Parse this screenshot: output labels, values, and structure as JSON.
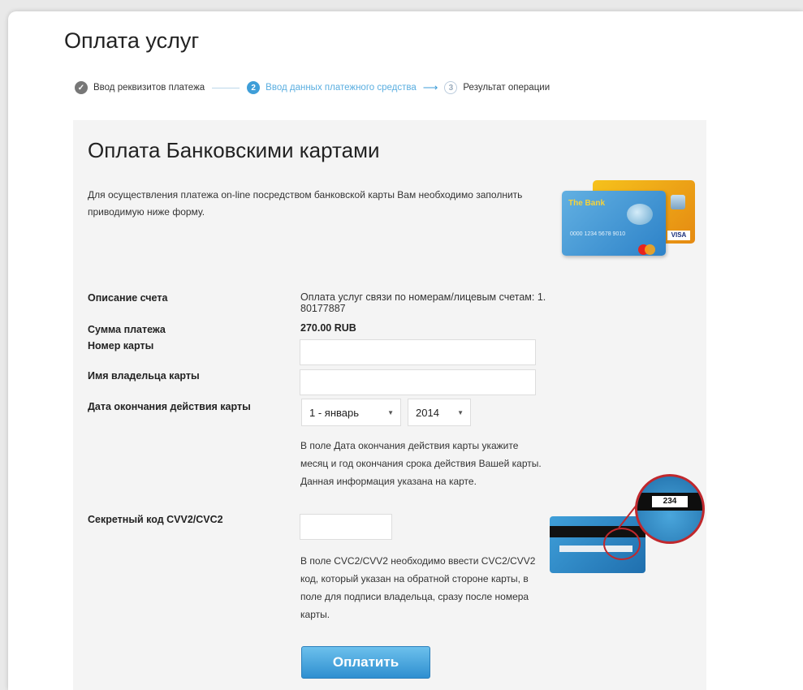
{
  "page": {
    "title": "Оплата услуг"
  },
  "steps": [
    {
      "number": "✓",
      "label": "Ввод реквизитов платежа",
      "state": "done"
    },
    {
      "number": "2",
      "label": "Ввод данных платежного средства",
      "state": "active"
    },
    {
      "number": "3",
      "label": "Результат операции",
      "state": "next"
    }
  ],
  "payment": {
    "heading": "Оплата Банковскими картами",
    "intro": "Для осуществления платежа on-line посредством банковской карты Вам необходимо заполнить приводимую ниже форму.",
    "description_label": "Описание счета",
    "description_value": "Оплата услуг связи по номерам/лицевым счетам: 1. 80177887",
    "amount_label": "Сумма платежа",
    "amount_value": "270.00 RUB",
    "card_number_label": "Номер карты",
    "card_number_value": "",
    "holder_label": "Имя владельца карты",
    "holder_value": "",
    "expiry_label": "Дата окончания действия карты",
    "expiry_month": "1 - январь",
    "expiry_year": "2014",
    "expiry_note": "В поле Дата окончания действия карты укажите месяц и год окончания срока действия Вашей карты. Данная информация указана на карте.",
    "cvv_label": "Секретный код CVV2/CVC2",
    "cvv_value": "",
    "cvv_note": "В поле CVC2/CVV2 необходимо ввести CVC2/CVV2 код, который указан на обратной стороне карты, в поле для подписи владельца, сразу после номера карты.",
    "pay_button": "Оплатить"
  },
  "illustrations": {
    "card_bank_name": "The Bank",
    "card_number": "0000 1234 5678 9010",
    "visa_text": "VISA",
    "cvv_sample": "234"
  },
  "colors": {
    "accent": "#3f9ed8",
    "button_top": "#6cc0ec",
    "button_bottom": "#2f8fd0",
    "panel_bg": "#f4f4f4",
    "highlight": "#c0282d"
  }
}
